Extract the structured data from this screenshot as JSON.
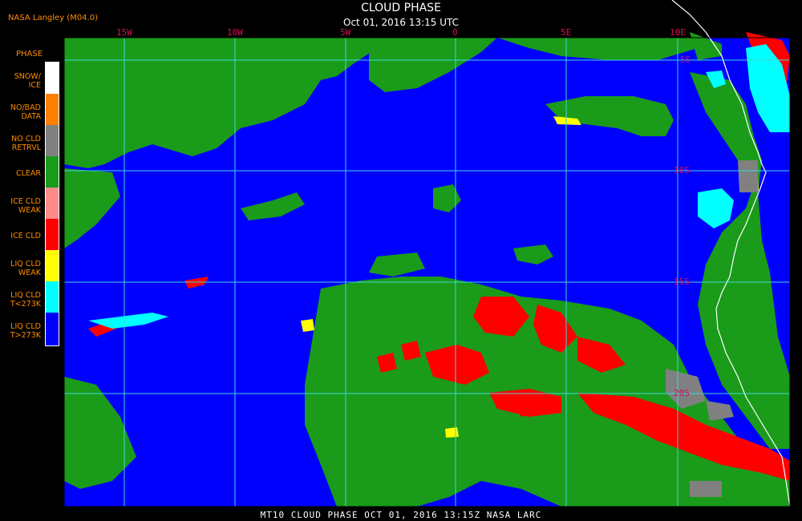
{
  "header": {
    "title": "CLOUD PHASE",
    "subtitle": "Oct 01, 2016 13:15 UTC",
    "source": "NASA Langley (M04.0)"
  },
  "legend": {
    "title": "PHASE",
    "items": [
      {
        "label": "SNOW/\nICE",
        "color": "#ffffff"
      },
      {
        "label": "NO/BAD\nDATA",
        "color": "#ff8000"
      },
      {
        "label": "NO CLD\nRETRVL",
        "color": "#808080"
      },
      {
        "label": "CLEAR",
        "color": "#1a9b1a"
      },
      {
        "label": "ICE CLD\nWEAK",
        "color": "#ff8a8a"
      },
      {
        "label": "ICE CLD",
        "color": "#ff0000"
      },
      {
        "label": "LIQ CLD\nWEAK",
        "color": "#ffff00"
      },
      {
        "label": "LIQ CLD\nT<273K",
        "color": "#00ffff"
      },
      {
        "label": "LIQ CLD\nT>273K",
        "color": "#0000ff"
      }
    ]
  },
  "grid": {
    "lon_labels": [
      "15W",
      "10W",
      "5W",
      "0",
      "5E",
      "10E"
    ],
    "lat_labels": [
      "5S",
      "10S",
      "15S",
      "20S"
    ],
    "line_color": "#3dd9d9"
  },
  "colors": {
    "ocean_liquid": "#0000ff",
    "clear": "#1a9b1a",
    "ice": "#ff0000",
    "cold_liquid": "#00ffff",
    "weak_liquid": "#ffff00",
    "no_retrieval": "#808080",
    "coast": "#ffffff"
  },
  "footer": {
    "text": "MT10  CLOUD PHASE  OCT 01, 2016 13:15Z  NASA LARC"
  }
}
